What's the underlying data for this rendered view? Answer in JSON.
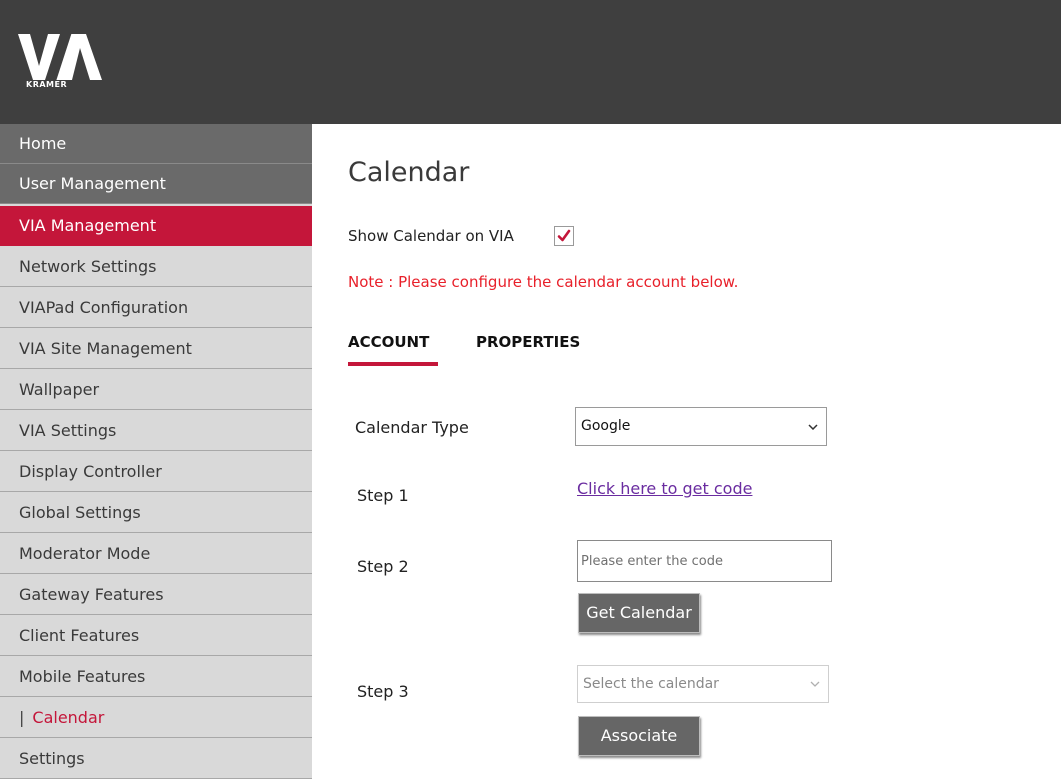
{
  "header": {
    "logo_alt": "VIA",
    "logo_subtext": "KRAMER"
  },
  "sidebar": {
    "items": [
      {
        "label": "Home"
      },
      {
        "label": "User Management"
      },
      {
        "label": "VIA Management"
      },
      {
        "label": "Network Settings"
      },
      {
        "label": "VIAPad Configuration"
      },
      {
        "label": "VIA Site Management"
      },
      {
        "label": "Wallpaper"
      },
      {
        "label": "VIA Settings"
      },
      {
        "label": "Display Controller"
      },
      {
        "label": "Global Settings"
      },
      {
        "label": "Moderator Mode"
      },
      {
        "label": "Gateway Features"
      },
      {
        "label": "Client Features"
      },
      {
        "label": "Mobile Features"
      },
      {
        "label": "Calendar",
        "prefix": "|"
      },
      {
        "label": "Settings"
      }
    ]
  },
  "main": {
    "title": "Calendar",
    "show_calendar_label": "Show Calendar on VIA",
    "show_calendar_checked": true,
    "note": "Note : Please configure the calendar account below.",
    "tabs": [
      {
        "label": "ACCOUNT",
        "active": true
      },
      {
        "label": "PROPERTIES",
        "active": false
      }
    ],
    "calendar_type_label": "Calendar Type",
    "calendar_type_value": "Google",
    "step1_label": "Step 1",
    "step1_link": "Click here to get code",
    "step2_label": "Step 2",
    "code_placeholder": "Please enter the code",
    "get_calendar_button": "Get Calendar",
    "step3_label": "Step 3",
    "select_calendar_placeholder": "Select the calendar",
    "associate_button": "Associate"
  },
  "colors": {
    "topbar": "#3f3f3f",
    "accent": "#c4163a",
    "note": "#e8202a",
    "sidebar": "#d9d9d9"
  }
}
